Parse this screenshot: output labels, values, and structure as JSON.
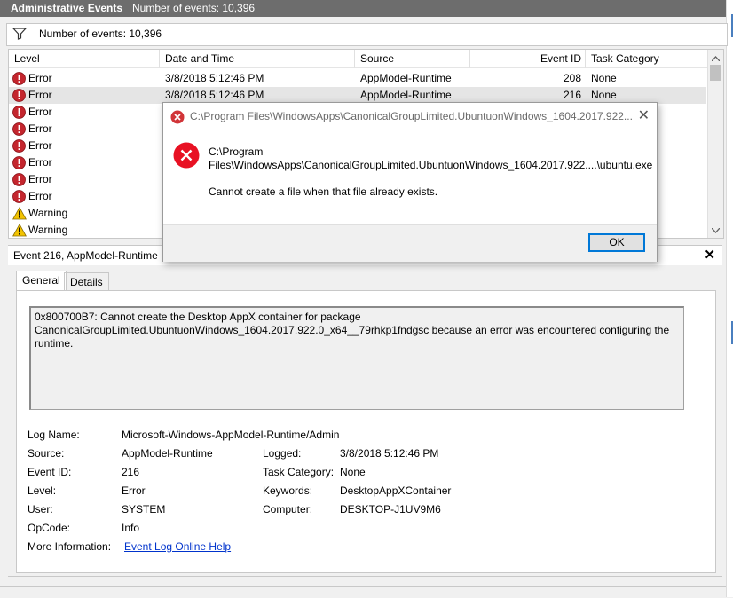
{
  "window": {
    "title": "Administrative Events",
    "count_label": "Number of events: 10,396"
  },
  "filter": {
    "text": "Number of events: 10,396"
  },
  "table": {
    "columns": [
      "Level",
      "Date and Time",
      "Source",
      "Event ID",
      "Task Category"
    ],
    "rows": [
      {
        "level": "Error",
        "date": "3/8/2018 5:12:46 PM",
        "source": "AppModel-Runtime",
        "id": "208",
        "task": "None",
        "icon": "error-icon"
      },
      {
        "level": "Error",
        "date": "3/8/2018 5:12:46 PM",
        "source": "AppModel-Runtime",
        "id": "216",
        "task": "None",
        "icon": "error-icon"
      },
      {
        "level": "Error",
        "icon": "error-icon"
      },
      {
        "level": "Error",
        "icon": "error-icon"
      },
      {
        "level": "Error",
        "icon": "error-icon"
      },
      {
        "level": "Error",
        "icon": "error-icon"
      },
      {
        "level": "Error",
        "icon": "error-icon"
      },
      {
        "level": "Error",
        "icon": "error-icon"
      },
      {
        "level": "Warning",
        "icon": "warning-icon"
      },
      {
        "level": "Warning",
        "icon": "warning-icon"
      }
    ]
  },
  "detail": {
    "header": "Event 216, AppModel-Runtime",
    "tabs": [
      "General",
      "Details"
    ],
    "description": "0x800700B7: Cannot create the Desktop AppX container for package CanonicalGroupLimited.UbuntuonWindows_1604.2017.922.0_x64__79rhkp1fndgsc because an error was encountered configuring the runtime.",
    "fields": {
      "log_name_label": "Log Name:",
      "log_name": "Microsoft-Windows-AppModel-Runtime/Admin",
      "source_label": "Source:",
      "source": "AppModel-Runtime",
      "logged_label": "Logged:",
      "logged": "3/8/2018 5:12:46 PM",
      "event_id_label": "Event ID:",
      "event_id": "216",
      "task_label": "Task Category:",
      "task": "None",
      "level_label": "Level:",
      "level": "Error",
      "keywords_label": "Keywords:",
      "keywords": "DesktopAppXContainer",
      "user_label": "User:",
      "user": "SYSTEM",
      "computer_label": "Computer:",
      "computer": "DESKTOP-J1UV9M6",
      "opcode_label": "OpCode:",
      "opcode": "Info",
      "more_info_label": "More Information:",
      "more_info_link": "Event Log Online Help"
    }
  },
  "dialog": {
    "title": "C:\\Program Files\\WindowsApps\\CanonicalGroupLimited.UbuntuonWindows_1604.2017.922...",
    "path_line1": "C:\\Program",
    "path_line2": "Files\\WindowsApps\\CanonicalGroupLimited.UbuntuonWindows_1604.2017.922....\\ubuntu.exe",
    "message": "Cannot create a file when that file already exists.",
    "ok_label": "OK",
    "close_glyph": "✕"
  },
  "colors": {
    "error": "#d13438",
    "warning": "#f2c300",
    "accent": "#0078d7"
  }
}
